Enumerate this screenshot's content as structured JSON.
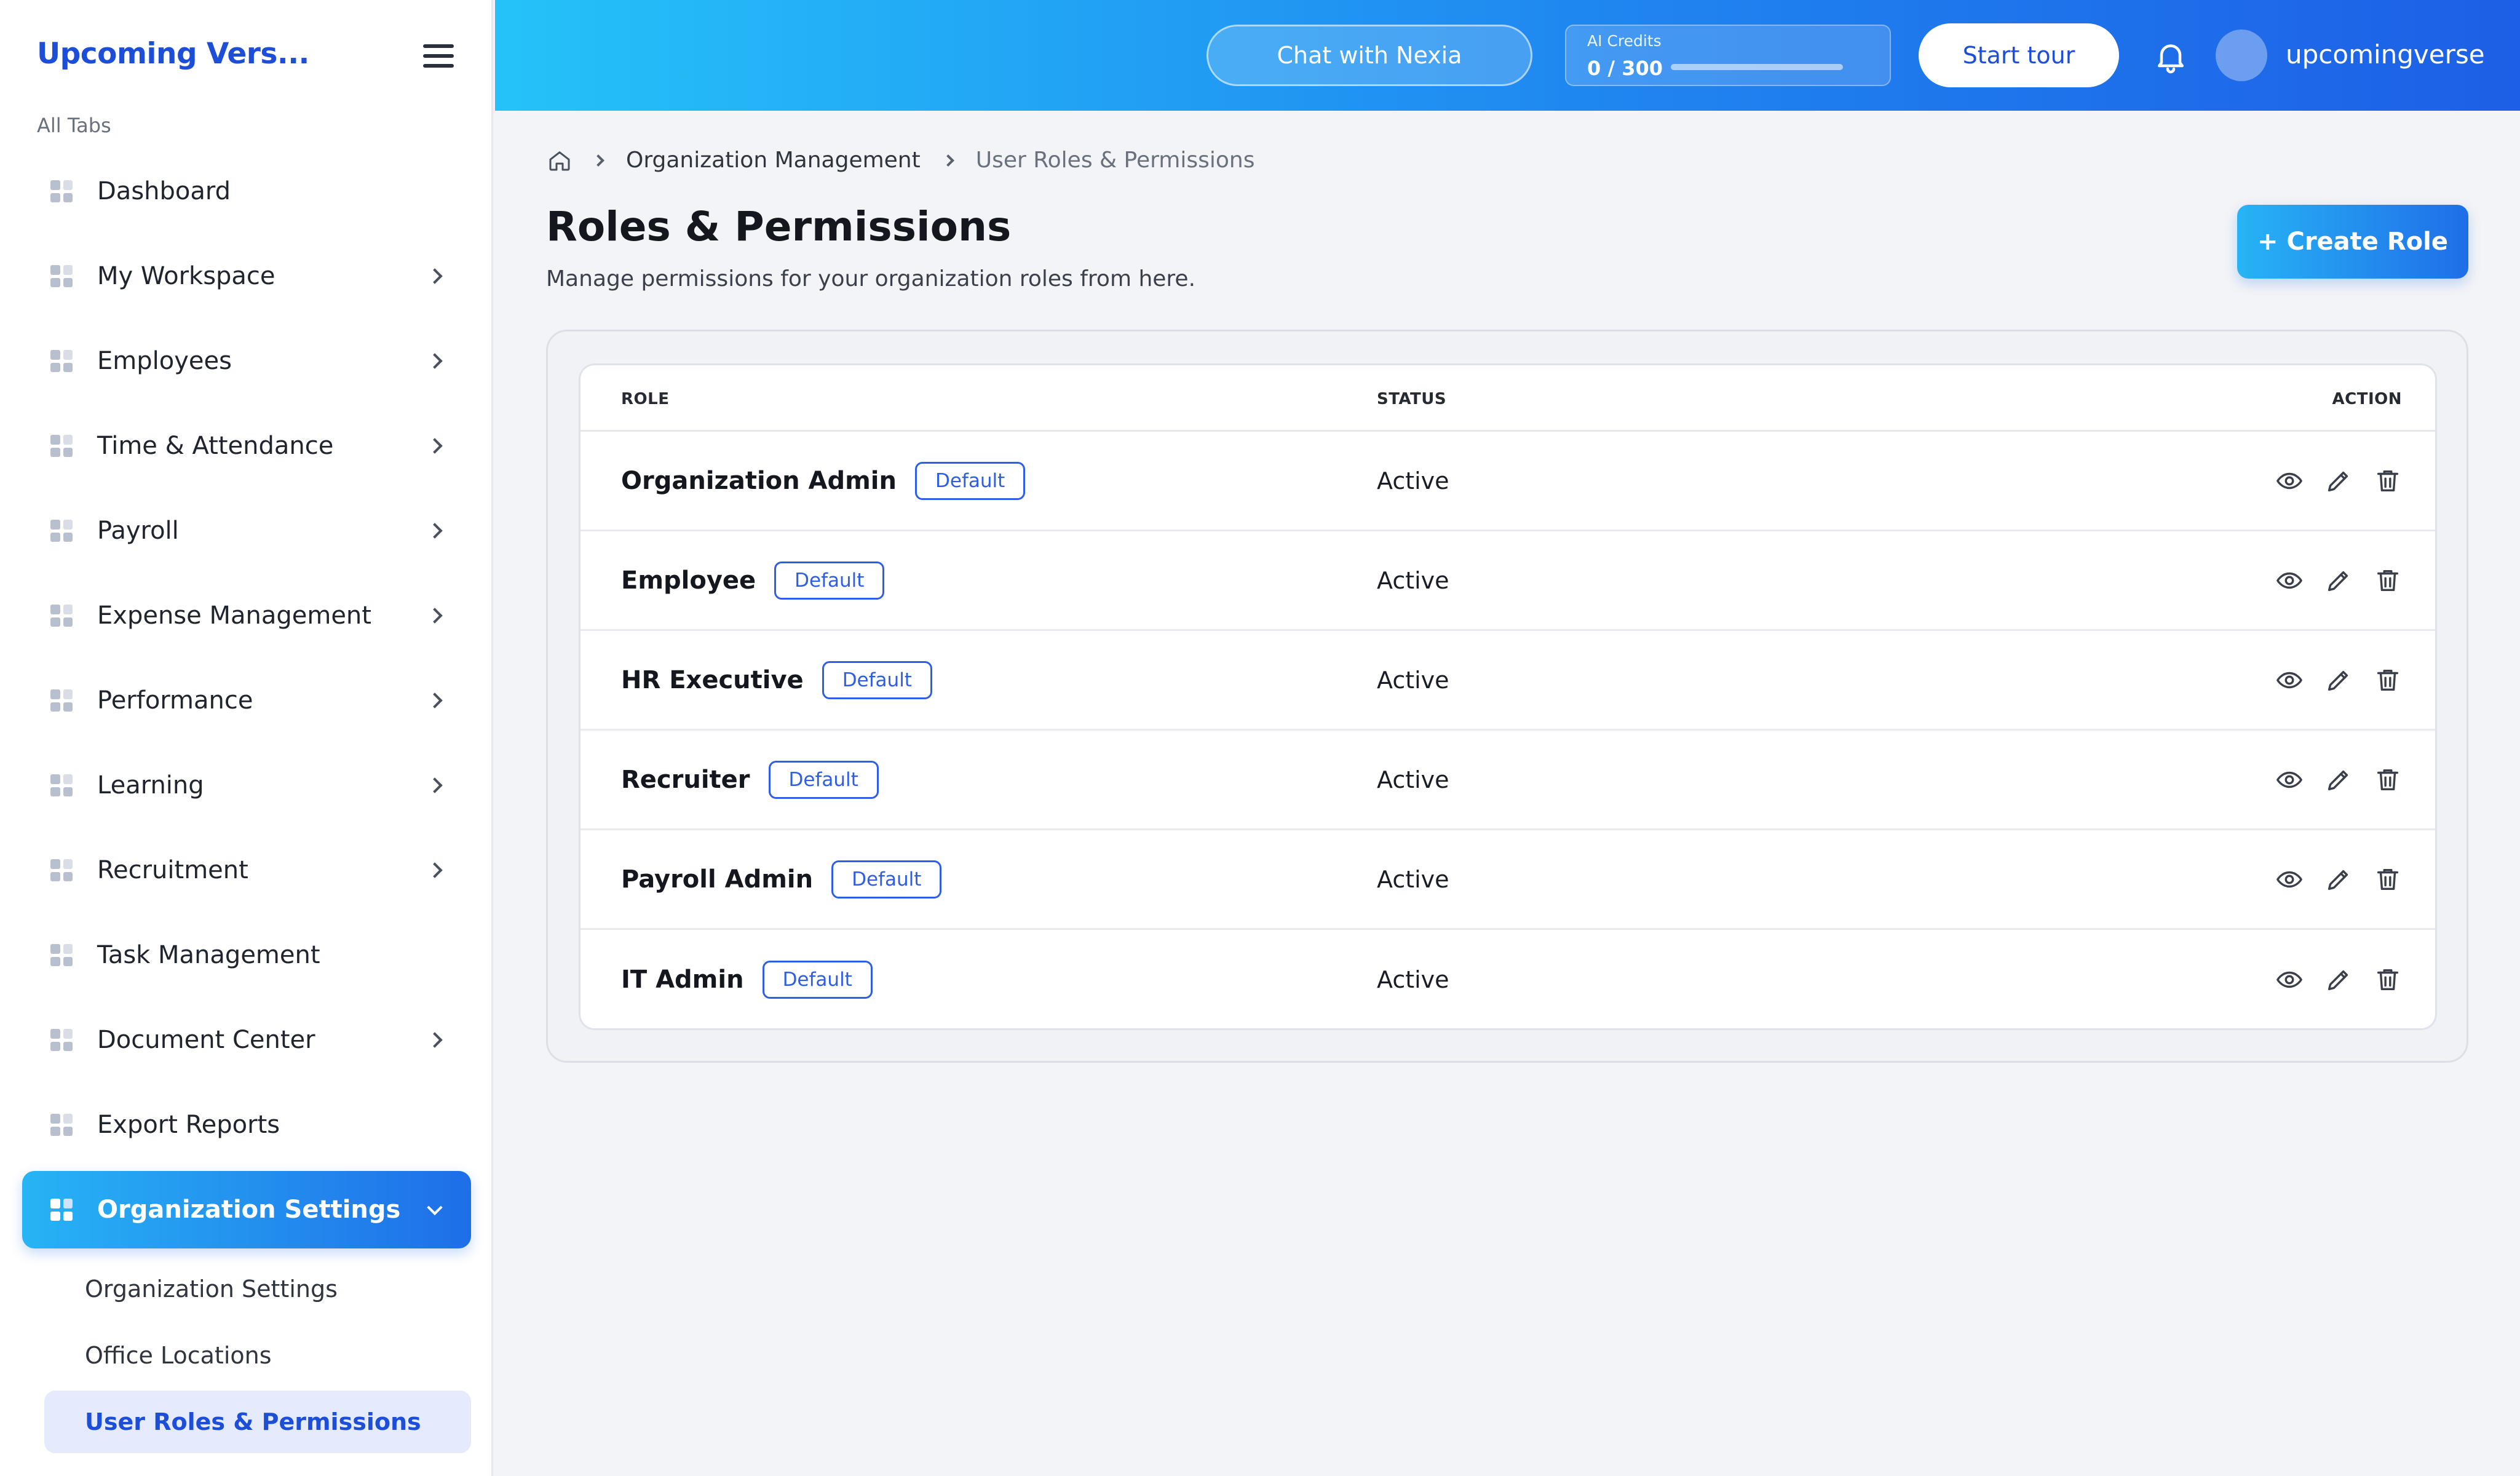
{
  "sidebar": {
    "brand": "Upcoming Vers...",
    "section_label": "All Tabs",
    "items": [
      {
        "label": "Dashboard",
        "has_chevron": false
      },
      {
        "label": "My Workspace",
        "has_chevron": true
      },
      {
        "label": "Employees",
        "has_chevron": true
      },
      {
        "label": "Time & Attendance",
        "has_chevron": true
      },
      {
        "label": "Payroll",
        "has_chevron": true
      },
      {
        "label": "Expense Management",
        "has_chevron": true
      },
      {
        "label": "Performance",
        "has_chevron": true
      },
      {
        "label": "Learning",
        "has_chevron": true
      },
      {
        "label": "Recruitment",
        "has_chevron": true
      },
      {
        "label": "Task Management",
        "has_chevron": false
      },
      {
        "label": "Document Center",
        "has_chevron": true
      },
      {
        "label": "Export Reports",
        "has_chevron": false
      },
      {
        "label": "Organization Settings",
        "has_chevron": true,
        "active": true
      }
    ],
    "subitems": [
      {
        "label": "Organization Settings"
      },
      {
        "label": "Office Locations"
      },
      {
        "label": "User Roles & Permissions",
        "selected": true
      }
    ]
  },
  "topbar": {
    "chat_label": "Chat with Nexia",
    "credits_label": "AI Credits",
    "credits_value": "0 / 300",
    "credits_fraction": 0,
    "tour_label": "Start tour",
    "username": "upcomingverse"
  },
  "breadcrumb": {
    "items": [
      "Organization Management",
      "User Roles & Permissions"
    ]
  },
  "page": {
    "title": "Roles & Permissions",
    "subtitle": "Manage permissions for your organization roles from here.",
    "create_label": "+ Create Role"
  },
  "table": {
    "headers": {
      "role": "ROLE",
      "status": "STATUS",
      "action": "ACTION"
    },
    "rows": [
      {
        "role": "Organization Admin",
        "badge": "Default",
        "status": "Active"
      },
      {
        "role": "Employee",
        "badge": "Default",
        "status": "Active"
      },
      {
        "role": "HR Executive",
        "badge": "Default",
        "status": "Active"
      },
      {
        "role": "Recruiter",
        "badge": "Default",
        "status": "Active"
      },
      {
        "role": "Payroll Admin",
        "badge": "Default",
        "status": "Active"
      },
      {
        "role": "IT Admin",
        "badge": "Default",
        "status": "Active"
      }
    ]
  },
  "colors": {
    "accent": "#1d4ed8",
    "gradient_start": "#27b4f5",
    "gradient_end": "#1f6ee8",
    "badge": "#2f5ee6"
  },
  "icons": {
    "view": "eye-icon",
    "edit": "pencil-icon",
    "delete": "trash-icon",
    "notifications": "bell-icon",
    "home": "home-icon",
    "menu": "hamburger-icon",
    "nav": "grid-icon"
  }
}
